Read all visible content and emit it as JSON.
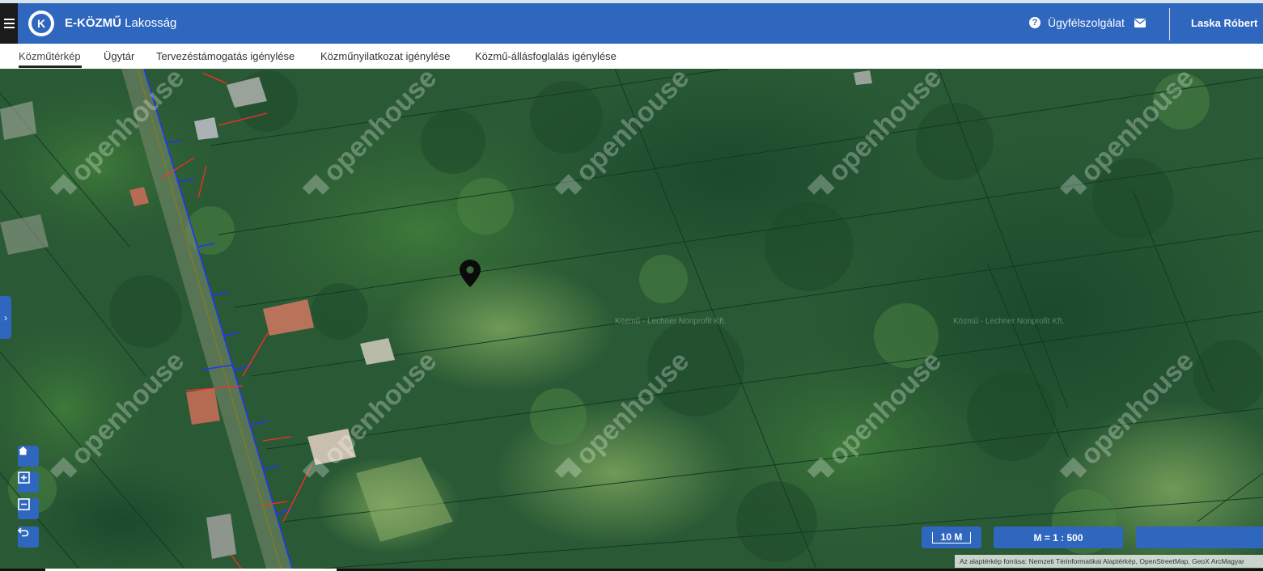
{
  "header": {
    "logo_letter": "K",
    "brand_bold": "E-KÖZMŰ",
    "brand_light": "Lakosság",
    "help_label": "Ügyfélszolgálat",
    "user_name": "Laska Róbert",
    "accent_color": "#2f66be"
  },
  "tabs": [
    {
      "label": "Közműtérkép",
      "active": true
    },
    {
      "label": "Ügytár",
      "active": false
    },
    {
      "label": "Tervezéstámogatás igénylése",
      "active": false
    },
    {
      "label": "Közműnyilatkozat igénylése",
      "active": false
    },
    {
      "label": "Közmű-állásfoglalás igénylése",
      "active": false
    }
  ],
  "map": {
    "watermark_text": "openhouse",
    "faint_label": "Közmű - Lechner Nonprofit Kft.",
    "scale_bar_label": "10 M",
    "scale_ratio_label": "M = 1 : 500",
    "attribution": "Az alaptérkép forrása: Nemzeti Térinformatikai Alaptérkép, OpenStreetMap, GeoX ArcMagyar",
    "controls": [
      "home-icon",
      "zoom-in-icon",
      "zoom-out-icon",
      "undo-icon"
    ],
    "marker_icon": "map-pin-icon"
  }
}
